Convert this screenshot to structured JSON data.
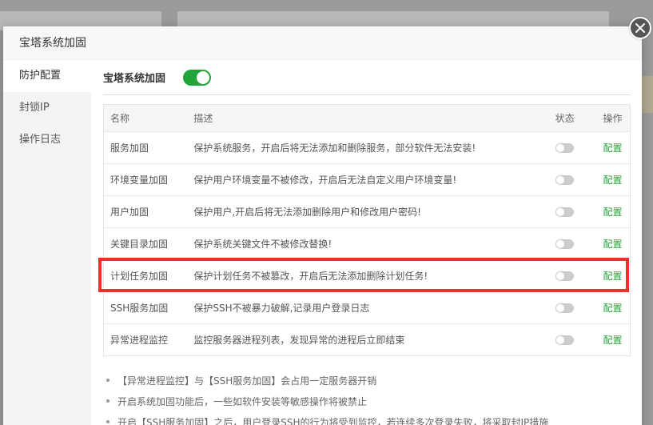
{
  "modal": {
    "title": "宝塔系统加固"
  },
  "sidebar": {
    "items": [
      {
        "label": "防护配置",
        "active": true
      },
      {
        "label": "封锁IP",
        "active": false
      },
      {
        "label": "操作日志",
        "active": false
      }
    ]
  },
  "main": {
    "title": "宝塔系统加固",
    "master_toggle_on": true,
    "table": {
      "headers": [
        "名称",
        "描述",
        "状态",
        "操作"
      ],
      "rows": [
        {
          "name": "服务加固",
          "desc": "保护系统服务，开启后将无法添加和删除服务，部分软件无法安装!",
          "status": false,
          "action": "配置"
        },
        {
          "name": "环境变量加固",
          "desc": "保护用户环境变量不被修改，开启后无法自定义用户环境变量!",
          "status": false,
          "action": "配置"
        },
        {
          "name": "用户加固",
          "desc": "保护用户,开启后将无法添加删除用户和修改用户密码!",
          "status": false,
          "action": "配置"
        },
        {
          "name": "关键目录加固",
          "desc": "保护系统关键文件不被修改替换!",
          "status": false,
          "action": "配置"
        },
        {
          "name": "计划任务加固",
          "desc": "保护计划任务不被篡改，开启后无法添加删除计划任务!",
          "status": false,
          "action": "配置"
        },
        {
          "name": "SSH服务加固",
          "desc": "保护SSH不被暴力破解,记录用户登录日志",
          "status": false,
          "action": "配置"
        },
        {
          "name": "异常进程监控",
          "desc": "监控服务器进程列表，发现异常的进程后立即结束",
          "status": false,
          "action": "配置"
        }
      ]
    },
    "notes": [
      "【异常进程监控】与【SSH服务加固】会占用一定服务器开销",
      "开启系统加固功能后，一些如软件安装等敏感操作将被禁止",
      "开启【SSH服务加固】之后，用户登录SSH的行为将受到监控，若连续多次登录失败，将采取封IP措施"
    ]
  },
  "colors": {
    "accent_green": "#20a53a",
    "highlight_red": "#ef2e2e"
  }
}
